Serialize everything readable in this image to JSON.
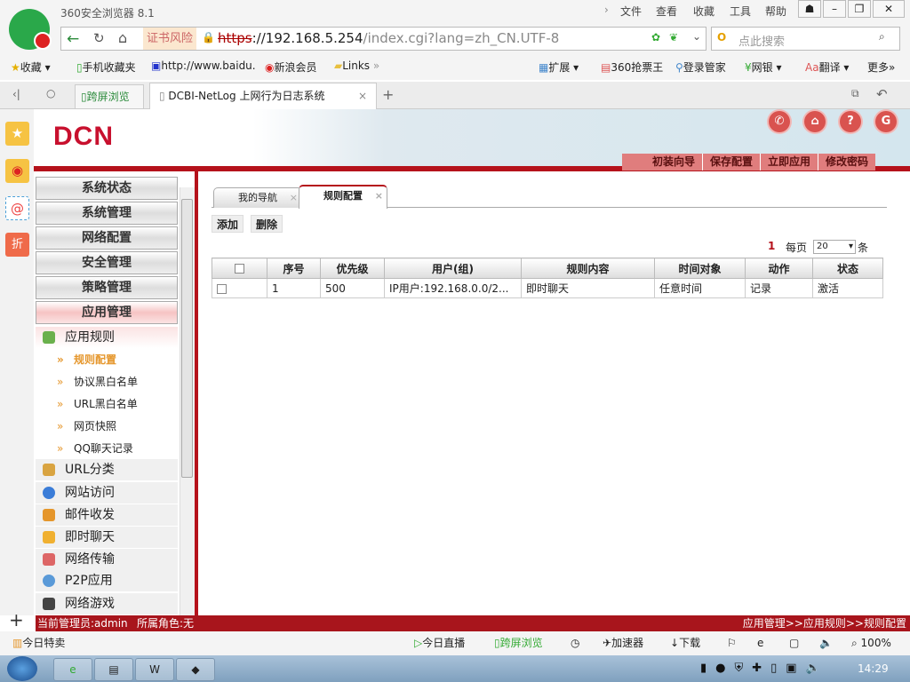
{
  "browser": {
    "title": "360安全浏览器 8.1",
    "menu": [
      "文件",
      "查看",
      "收藏",
      "工具",
      "帮助"
    ],
    "cert_warning": "证书风险",
    "url_scheme": "https",
    "url_host": "://192.168.5.254",
    "url_path": "/index.cgi?lang=zh_CN.UTF-8",
    "search_placeholder": "点此搜索",
    "bookmarks": [
      "收藏",
      "手机收藏夹",
      "http://www.baidu.",
      "新浪会员",
      "Links"
    ],
    "bookmarks_right": [
      "扩展",
      "360抢票王",
      "登录管家",
      "网银",
      "翻译",
      "更多"
    ],
    "tabs": {
      "cross_screen": "跨屏浏览",
      "active": "DCBI-NetLog 上网行为日志系统"
    }
  },
  "header": {
    "logo": "DCN",
    "nav": [
      "初装向导",
      "保存配置",
      "立即应用",
      "修改密码"
    ]
  },
  "sidebar": {
    "menus": [
      "系统状态",
      "系统管理",
      "网络配置",
      "安全管理",
      "策略管理",
      "应用管理"
    ],
    "subcat": "应用规则",
    "subitems": [
      "规则配置",
      "协议黑白名单",
      "URL黑白名单",
      "网页快照",
      "QQ聊天记录"
    ],
    "categories": [
      "URL分类",
      "网站访问",
      "邮件收发",
      "即时聊天",
      "网络传输",
      "P2P应用",
      "网络游戏"
    ]
  },
  "content": {
    "tabs": [
      "我的导航",
      "规则配置"
    ],
    "buttons": {
      "add": "添加",
      "delete": "删除"
    },
    "pager": {
      "page": "1",
      "per_page_label": "每页",
      "per_page": "20",
      "unit": "条"
    },
    "columns": [
      "序号",
      "优先级",
      "用户(组)",
      "规则内容",
      "时间对象",
      "动作",
      "状态"
    ],
    "rows": [
      [
        "1",
        "500",
        "IP用户:192.168.0.0/2...",
        "即时聊天",
        "任意时间",
        "记录",
        "激活"
      ]
    ]
  },
  "statusbar": {
    "admin": "当前管理员:admin",
    "role": "所属角色:无",
    "breadcrumb": "应用管理>>应用规则>>规则配置"
  },
  "browser_status": {
    "left": "今日特卖",
    "items": [
      "今日直播",
      "跨屏浏览",
      "加速器",
      "下载"
    ],
    "zoom": "100%"
  },
  "taskbar": {
    "time": "14:29"
  }
}
